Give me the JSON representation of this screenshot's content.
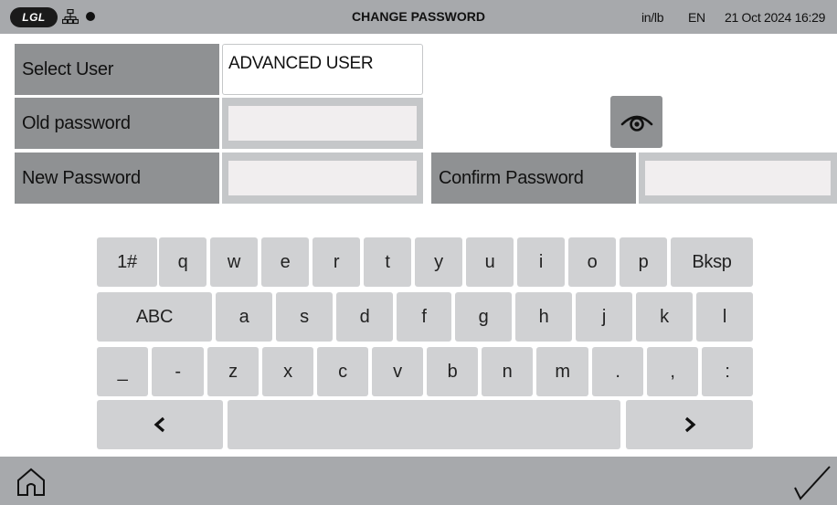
{
  "header": {
    "logo_text": "LGL",
    "title": "CHANGE PASSWORD",
    "units": "in/lb",
    "language": "EN",
    "datetime": "21 Oct 2024 16:29"
  },
  "form": {
    "select_user_label": "Select User",
    "select_user_value": "ADVANCED USER",
    "old_password_label": "Old password",
    "old_password_value": "",
    "new_password_label": "New Password",
    "new_password_value": "",
    "confirm_password_label": "Confirm Password",
    "confirm_password_value": ""
  },
  "keyboard": {
    "row1": [
      "1#",
      "q",
      "w",
      "e",
      "r",
      "t",
      "y",
      "u",
      "i",
      "o",
      "p",
      "Bksp"
    ],
    "row2": [
      "ABC",
      "a",
      "s",
      "d",
      "f",
      "g",
      "h",
      "j",
      "k",
      "l"
    ],
    "row3": [
      "_",
      "-",
      "z",
      "x",
      "c",
      "v",
      "b",
      "n",
      "m",
      ".",
      ",",
      ":"
    ],
    "row4": [
      "‹",
      "",
      "›"
    ]
  },
  "icons": {
    "network": "network-icon",
    "status_dot": "status-dot-icon",
    "eye": "eye-icon",
    "home": "home-icon",
    "confirm": "checkmark-icon"
  },
  "colors": {
    "bar": "#a7a9ac",
    "label": "#8f9193",
    "key": "#d0d1d3",
    "field": "#f1eeef"
  }
}
